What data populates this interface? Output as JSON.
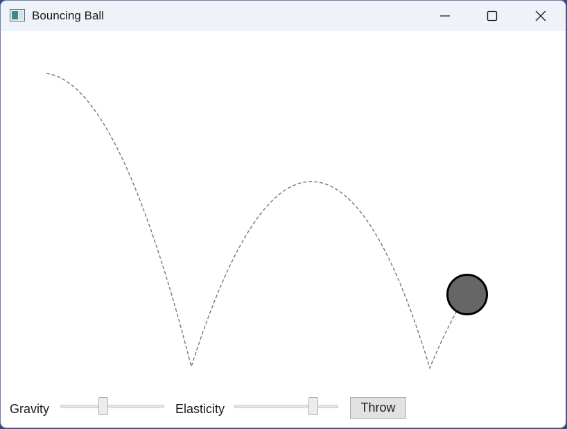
{
  "window": {
    "title": "Bouncing Ball",
    "icon": "app-window-icon",
    "caption_buttons": [
      "minimize-icon",
      "maximize-icon",
      "close-icon"
    ]
  },
  "controls": {
    "gravity": {
      "label": "Gravity",
      "value": 0.42
    },
    "elasticity": {
      "label": "Elasticity",
      "value": 0.79
    },
    "throw_label": "Throw"
  },
  "colors": {
    "ball_fill": "#666666",
    "ball_stroke": "#000000",
    "trajectory": "#777777",
    "titlebar": "#eff3f9"
  }
}
